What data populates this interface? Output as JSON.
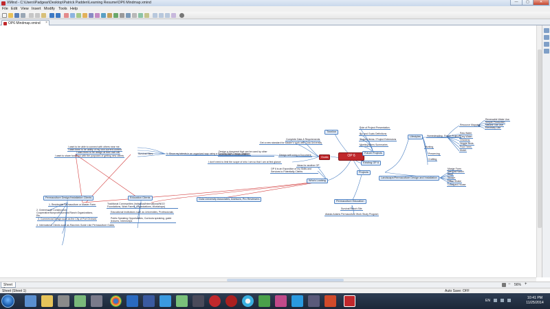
{
  "window": {
    "title": "XMind - C:\\Users\\Padgear\\Desktop\\Patrick Padden\\Learning Resume\\OP6 Mindmap.xmind",
    "min": "—",
    "max": "▢",
    "close": "✕"
  },
  "menu": [
    "File",
    "Edit",
    "View",
    "Insert",
    "Modify",
    "Tools",
    "Help"
  ],
  "tab": {
    "label": "OP6 Mindmap.xmind",
    "close": "×"
  },
  "map": {
    "central": "OP 6",
    "goals": "Goals",
    "timeline": "Timeline",
    "future_projects": "Future Projects",
    "existing_op6": "Existing OP 6",
    "projects": "Projects",
    "whos_looking": "Who's Looking",
    "goal_items": [
      "Complete Data & Requirements",
      "Get a new standard for Master's work with Guta University",
      "Design a document that can be used by other professions in communities",
      "Design self using a Document",
      "I don't need to limit the scope of who I am so that I am at first glance"
    ],
    "goal_mid": "Design a document that can be used by other professions in communities",
    "goal_mid2": "1: Show my talents in an organized way using a Survival Style Design Strategy",
    "left_items": [
      "I want to be able to connect with others near me.",
      "I want them to be ability of my own current content",
      "I want them to be design at their own will",
      "I want to share functions with the purposes of getting new clients"
    ],
    "left_label": "Survival Sites:",
    "timeline_items": [
      "Role of Project Presentation",
      "Bio and Goals Definitions",
      "Shapes Items / Project Extensions",
      "Meeting Items Summaries"
    ],
    "looking_items": [
      "Ideas for another OP",
      "OP 6 is an Exposition of my Skills and Services to Potentially Clients"
    ],
    "lifestyles": "Lifestyles",
    "lifestyle_sub": "Homesteading",
    "lifestyle_sub2": "Future Projects",
    "lifestyle_items": [
      "Resource Mapping",
      "Hunting",
      "Preserving",
      "Crafting"
    ],
    "farm_items": [
      "Renewable Water Use",
      "Simple Production",
      "Natural Gas Use",
      "Electricity Use"
    ],
    "farm_items2": [
      "Raw Water",
      "Grey Water",
      "Chickens",
      "Veggie Beds",
      "Fruit Trees",
      "Mulch"
    ],
    "landscape": "Landscape/Permaculture Design and Installation",
    "landscape_items": [
      "Master Farm",
      "Survival Ranch",
      "Zone",
      "Stream",
      "Office Shake",
      "Courtyard House"
    ],
    "permaculture_ed": "Permaculture Education",
    "perm_ed_items": [
      "Survival Ranch Site",
      "Alaska Adams Permaculture Work Study Program"
    ],
    "perm_clients": "Permaculture Design/Installation Clients",
    "perm_client_items": [
      "1. Residential Permaculture or Master Farm",
      "2. Greenhouse Construction Cooperative/Nonprofit/Survival Ranch Organizations, Etc.",
      "3. Commercial Design such as the City of Port Orchard",
      "4. International Clients such as Ranches Guide Like Permaculture Guilds"
    ],
    "edu_clients": "Education Clients",
    "edu_client_items": [
      "Traditional Communities (Individual/International/NGO Foundations, Work Farms, Organizations, Workshops)",
      "Educational Institutions such as Universities, Professionals",
      "Public Speaking Opportunities, Curricula speaking, guide lectures, Internships"
    ],
    "guta": "Guta University Associates, Advisors, Pro Reviewers"
  },
  "sheet": {
    "tab": "Sheet 1",
    "zoom": "56%"
  },
  "status": {
    "left": "Sheet (Sheet 1)",
    "autosave": "Auto Save: OFF"
  },
  "taskbar": {
    "lang": "EN",
    "time": "10:41 PM",
    "date": "11/25/2014"
  },
  "colors": {
    "accent": "#c0282c",
    "link": "#4a7fc2",
    "relation": "#d23a3a"
  }
}
